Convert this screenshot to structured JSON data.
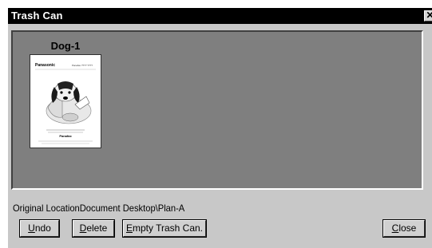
{
  "window": {
    "title": "Trash Can",
    "close_glyph": "✕"
  },
  "items": [
    {
      "label": "Dog-1",
      "thumbnail_brand": "Panasonic",
      "thumbnail_header_right": "Panafax ???? ????",
      "thumbnail_footer": "Panafax"
    }
  ],
  "location_text": "Original LocationDocument Desktop\\Plan-A",
  "buttons": {
    "undo": {
      "mnemonic": "U",
      "rest": "ndo"
    },
    "delete": {
      "mnemonic": "D",
      "rest": "elete"
    },
    "empty": {
      "mnemonic": "E",
      "rest": "mpty Trash Can."
    },
    "close": {
      "mnemonic": "C",
      "rest": "lose"
    }
  }
}
